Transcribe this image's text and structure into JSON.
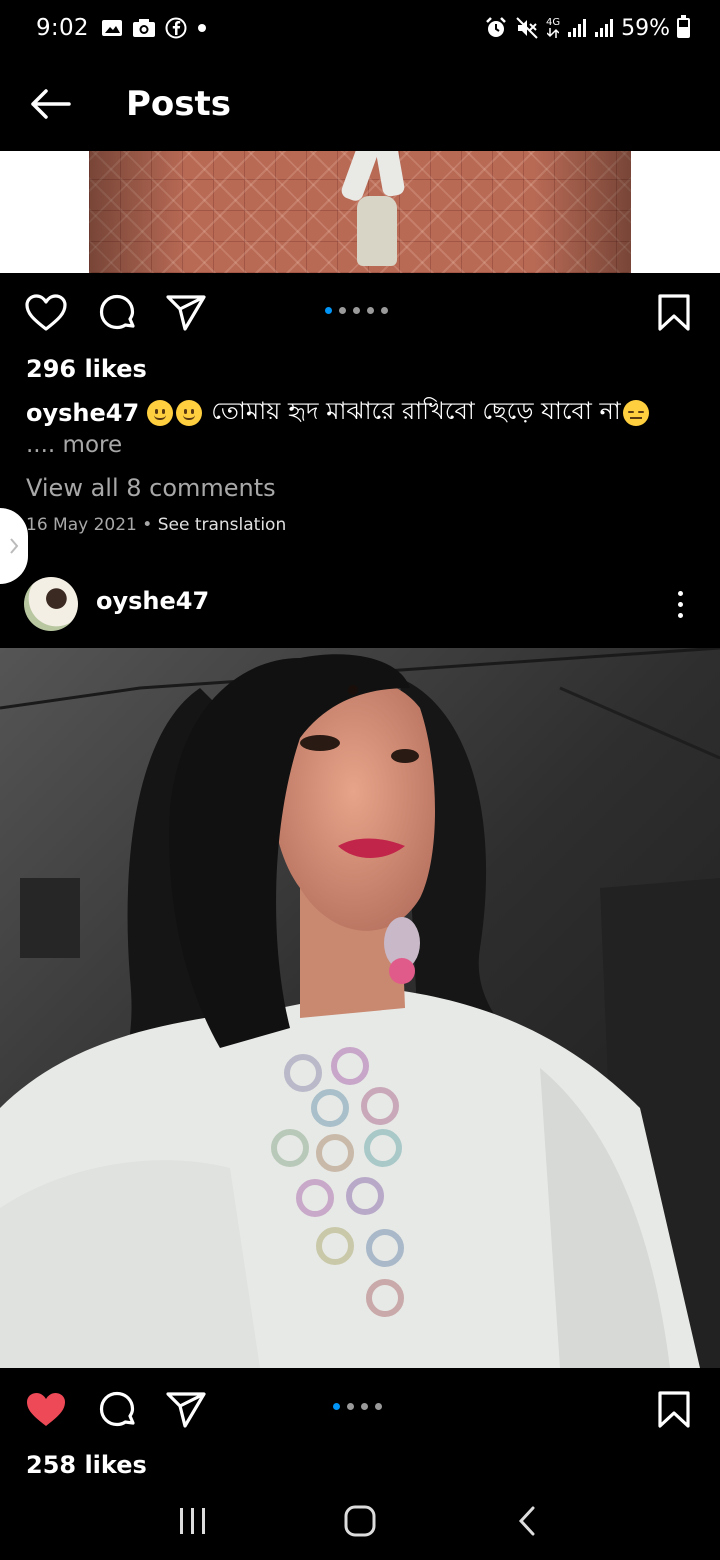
{
  "status_bar": {
    "time": "9:02",
    "network": "4G",
    "battery": "59%",
    "battery_level": 0.59,
    "left_icons": [
      "gallery-icon",
      "camera-icon",
      "facebook-icon",
      "dot-icon"
    ],
    "right_icons": [
      "alarm-icon",
      "mute-icon",
      "signal-icon",
      "signal-icon",
      "battery-icon"
    ]
  },
  "header": {
    "title": "Posts",
    "back_icon": "arrow-left-icon"
  },
  "post1": {
    "likes": "296 likes",
    "username": "oyshe47",
    "caption": "তোমায় হৃদ মাঝারে রাখিবো ছেড়ে যাবো না",
    "more": ".... more",
    "view_comments": "View all 8 comments",
    "date": "16 May 2021",
    "separator": "•",
    "see_translation": "See translation",
    "carousel_count": 5,
    "carousel_active": 0,
    "liked": false
  },
  "post2": {
    "username": "oyshe47",
    "likes": "258 likes",
    "carousel_count": 4,
    "carousel_active": 0,
    "liked": true,
    "like_color": "#ed4956"
  },
  "colors": {
    "accent": "#0095f6",
    "background": "#000000",
    "muted_text": "#a8a8a8"
  },
  "nav": {
    "recents_icon": "recents-icon",
    "home_icon": "home-icon",
    "back_icon": "back-icon"
  }
}
